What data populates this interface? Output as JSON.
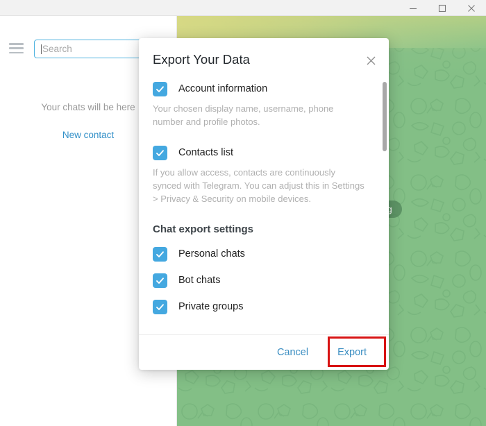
{
  "window": {
    "controls": [
      {
        "name": "minimize",
        "glyph": "minimize-icon"
      },
      {
        "name": "maximize",
        "glyph": "maximize-icon"
      },
      {
        "name": "close",
        "glyph": "close-icon"
      }
    ]
  },
  "sidebar": {
    "menu_icon": "hamburger-menu-icon",
    "search": {
      "placeholder": "Search",
      "value": ""
    },
    "empty_state": "Your chats will be here",
    "new_contact_label": "New contact"
  },
  "chat_area": {
    "status_pill": "Connecting",
    "background_color": "#83bf86",
    "gradient_top_color": "#d9da86"
  },
  "dialog": {
    "title": "Export Your Data",
    "close_icon": "close-icon",
    "options": [
      {
        "label": "Account information",
        "checked": true,
        "description": "Your chosen display name, username, phone number and profile photos."
      },
      {
        "label": "Contacts list",
        "checked": true,
        "description": "If you allow access, contacts are continuously synced with Telegram. You can adjust this in Settings > Privacy & Security on mobile devices."
      }
    ],
    "section_title": "Chat export settings",
    "chat_options": [
      {
        "label": "Personal chats",
        "checked": true
      },
      {
        "label": "Bot chats",
        "checked": true
      },
      {
        "label": "Private groups",
        "checked": true
      }
    ],
    "cancel_label": "Cancel",
    "export_label": "Export",
    "accent_color": "#44a8e0",
    "link_color": "#3b8ec2",
    "highlight_color": "#d81313"
  }
}
